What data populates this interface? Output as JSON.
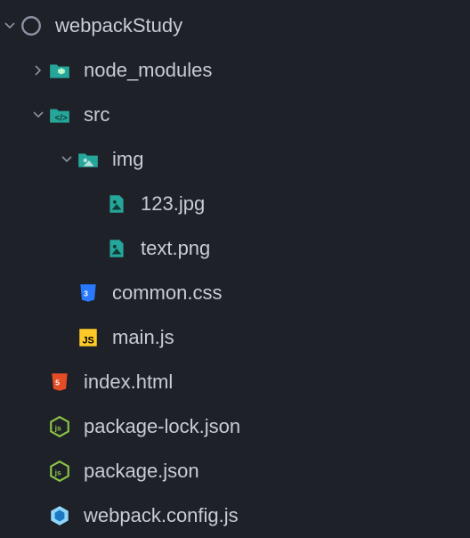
{
  "tree": {
    "root": {
      "name": "webpackStudy",
      "expanded": true,
      "children": [
        {
          "name": "node_modules",
          "type": "folder",
          "icon": "folder-node",
          "expanded": false
        },
        {
          "name": "src",
          "type": "folder",
          "icon": "folder-src",
          "expanded": true,
          "children": [
            {
              "name": "img",
              "type": "folder",
              "icon": "folder-img",
              "expanded": true,
              "children": [
                {
                  "name": "123.jpg",
                  "type": "file",
                  "icon": "image"
                },
                {
                  "name": "text.png",
                  "type": "file",
                  "icon": "image"
                }
              ]
            },
            {
              "name": "common.css",
              "type": "file",
              "icon": "css"
            },
            {
              "name": "main.js",
              "type": "file",
              "icon": "js"
            }
          ]
        },
        {
          "name": "index.html",
          "type": "file",
          "icon": "html"
        },
        {
          "name": "package-lock.json",
          "type": "file",
          "icon": "nodejs"
        },
        {
          "name": "package.json",
          "type": "file",
          "icon": "nodejs"
        },
        {
          "name": "webpack.config.js",
          "type": "file",
          "icon": "webpack"
        }
      ]
    }
  }
}
